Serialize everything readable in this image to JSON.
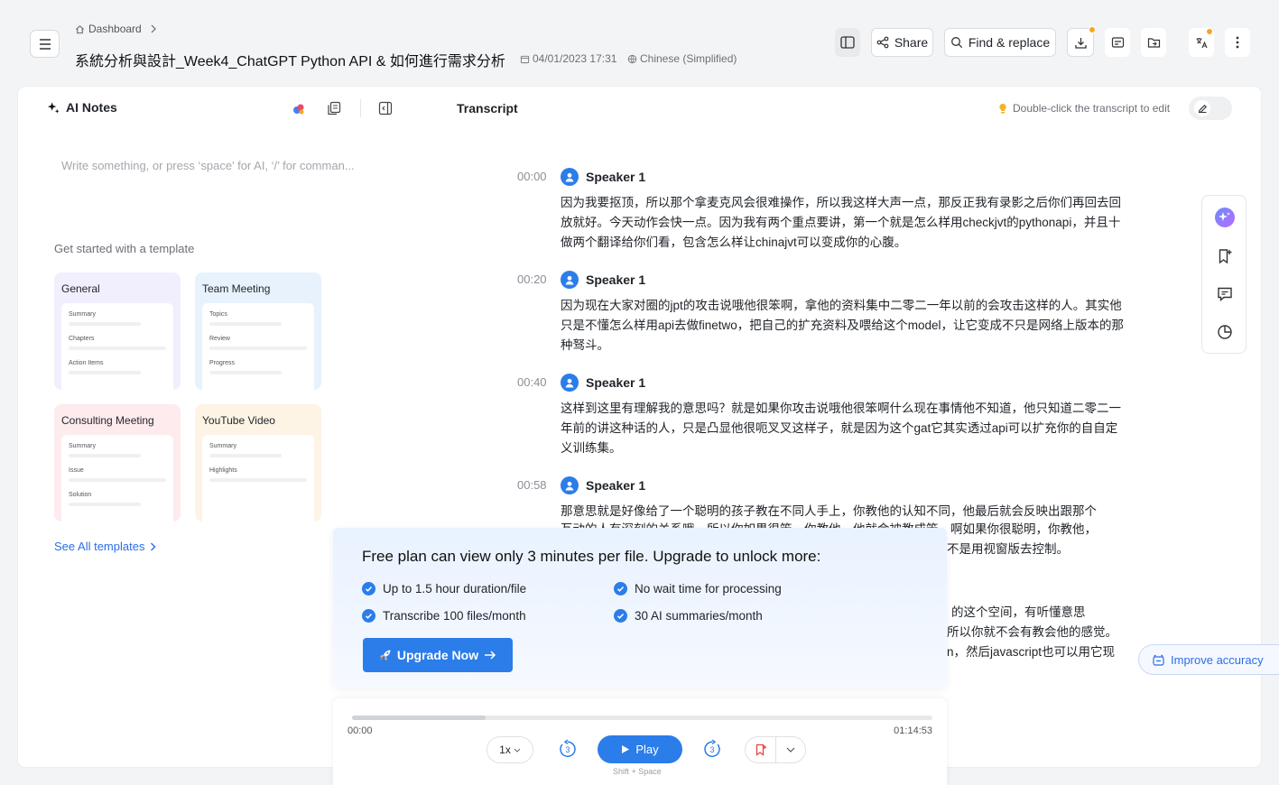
{
  "header": {
    "breadcrumb": "Dashboard",
    "title": "系統分析與設計_Week4_ChatGPT Python API & 如何進行需求分析",
    "datetime": "04/01/2023 17:31",
    "language": "Chinese (Simplified)",
    "share_label": "Share",
    "find_replace_label": "Find & replace"
  },
  "notes": {
    "title": "AI Notes",
    "placeholder": "Write something, or press ‘space’ for AI, ‘/’ for comman...",
    "get_started": "Get started with a template",
    "templates": [
      {
        "name": "General",
        "rows": [
          "Summary",
          "Chapters",
          "Action Items"
        ],
        "color": "#f1eefd"
      },
      {
        "name": "Team Meeting",
        "rows": [
          "Topics",
          "Review",
          "Progress"
        ],
        "color": "#e8f2fd"
      },
      {
        "name": "Consulting Meeting",
        "rows": [
          "Summary",
          "Issue",
          "Solution"
        ],
        "color": "#fdebee"
      },
      {
        "name": "YouTube Video",
        "rows": [
          "Summary",
          "Highlights"
        ],
        "color": "#fdf4e6"
      }
    ],
    "see_all": "See All templates"
  },
  "transcript": {
    "title": "Transcript",
    "hint": "Double-click the transcript to edit",
    "segments": [
      {
        "time": "00:00",
        "speaker": "Speaker 1",
        "text": "因为我要抠顶，所以那个拿麦克风会很难操作，所以我这样大声一点，那反正我有录影之后你们再回去回放就好。今天动作会快一点。因为我有两个重点要讲，第一个就是怎么样用checkjvt的pythonapi，并且十做两个翻译给你们看，包含怎么样让chinajvt可以变成你的心腹。"
      },
      {
        "time": "00:20",
        "speaker": "Speaker 1",
        "text": "因为现在大家对圈的jpt的攻击说哦他很笨啊，拿他的资料集中二零二一年以前的会攻击这样的人。其实他只是不懂怎么样用api去做finetwo，把自己的扩充资料及喂给这个model，让它变成不只是网络上版本的那种驽斗。"
      },
      {
        "time": "00:40",
        "speaker": "Speaker 1",
        "text": "这样到这里有理解我的意思吗？就是如果你攻击说哦他很笨啊什么现在事情他不知道，他只知道二零二一年前的讲这种话的人，只是凸显他很呃叉叉这样子，就是因为这个gat它其实透过api可以扩充你的自自定义训练集。"
      },
      {
        "time": "00:58",
        "speaker": "Speaker 1",
        "text": "那意思就是好像给了一个聪明的孩子教在不同人手上，你教他的认知不同，他最后就会反映出跟那个"
      }
    ],
    "partial_lines": [
      "互动的人有深刻的关系哦，所以你如果很笨，你教他，他就会被教成笨。啊如果你很聪明，你教他，",
      "不是用视窗版去控制。",
      "的这个空间，有听懂意思",
      "所以你就不会有教会他的感觉。",
      "n，然后javascript也可以用它现"
    ]
  },
  "improve_label": "Improve accuracy",
  "upgrade": {
    "headline": "Free plan can view only 3 minutes per file. Upgrade to unlock more:",
    "features": [
      "Up to 1.5 hour duration/file",
      "No wait time for processing",
      "Transcribe 100 files/month",
      "30 AI summaries/month"
    ],
    "button": "Upgrade Now"
  },
  "player": {
    "current": "00:00",
    "total": "01:14:53",
    "progress_fraction": 0.23,
    "speed": "1x",
    "skip_seconds": "3",
    "play_label": "Play",
    "shortcut": "Shift + Space"
  }
}
